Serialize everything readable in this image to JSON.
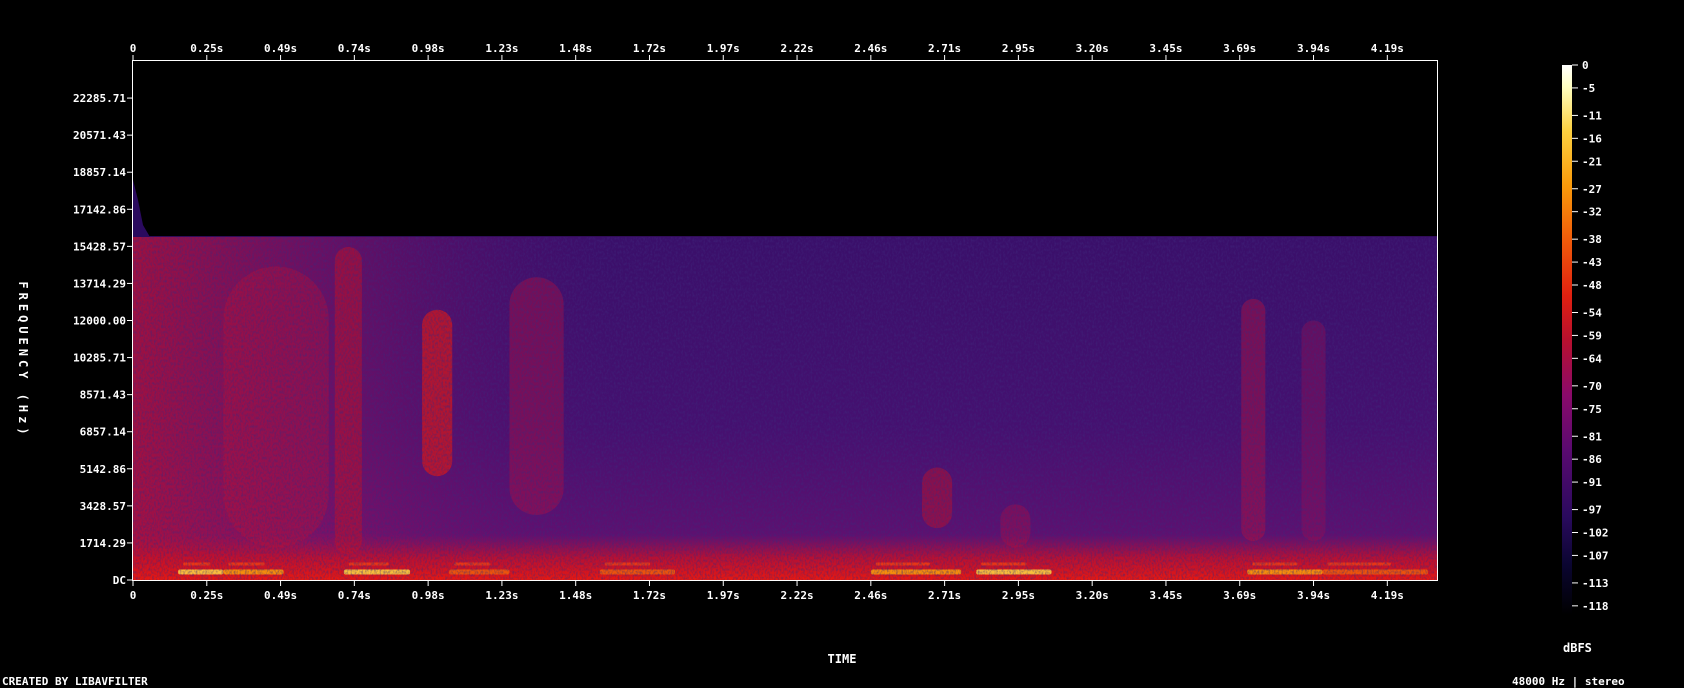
{
  "chart_data": {
    "type": "heatmap",
    "title": "",
    "xlabel": "TIME",
    "ylabel": "FREQUENCY (Hz)",
    "x_ticks": [
      "0",
      "0.25s",
      "0.49s",
      "0.74s",
      "0.98s",
      "1.23s",
      "1.48s",
      "1.72s",
      "1.97s",
      "2.22s",
      "2.46s",
      "2.71s",
      "2.95s",
      "3.20s",
      "3.45s",
      "3.69s",
      "3.94s",
      "4.19s"
    ],
    "x_tick_values": [
      0,
      0.245,
      0.49,
      0.735,
      0.98,
      1.225,
      1.47,
      1.715,
      1.96,
      2.205,
      2.45,
      2.695,
      2.94,
      3.185,
      3.43,
      3.675,
      3.92,
      4.165
    ],
    "xlim": [
      0,
      4.33
    ],
    "y_ticks": [
      "DC",
      "1714.29",
      "3428.57",
      "5142.86",
      "6857.14",
      "8571.43",
      "10285.71",
      "12000.00",
      "13714.29",
      "15428.57",
      "17142.86",
      "18857.14",
      "20571.43",
      "22285.71"
    ],
    "y_tick_values": [
      0,
      1714.29,
      3428.57,
      5142.86,
      6857.14,
      8571.43,
      10285.71,
      12000,
      13714.29,
      15428.57,
      17142.86,
      18857.14,
      20571.43,
      22285.71
    ],
    "ylim": [
      0,
      24000
    ],
    "spectrum_cutoff_hz": 15900,
    "colorbar": {
      "label": "dBFS",
      "ticks": [
        "0",
        "-5",
        "-11",
        "-16",
        "-21",
        "-27",
        "-32",
        "-38",
        "-43",
        "-48",
        "-54",
        "-59",
        "-64",
        "-70",
        "-75",
        "-81",
        "-86",
        "-91",
        "-97",
        "-102",
        "-107",
        "-113",
        "-118"
      ],
      "range": [
        -120,
        0
      ],
      "colors": [
        "#000000",
        "#0a0530",
        "#2a0a5e",
        "#5a0a70",
        "#8a0a6a",
        "#b8102e",
        "#e02010",
        "#f05a0a",
        "#fa9a0a",
        "#fcd040",
        "#ffffc0",
        "#ffffff"
      ]
    },
    "footer_left": "CREATED BY LIBAVFILTER",
    "footer_right": "48000 Hz | stereo"
  }
}
